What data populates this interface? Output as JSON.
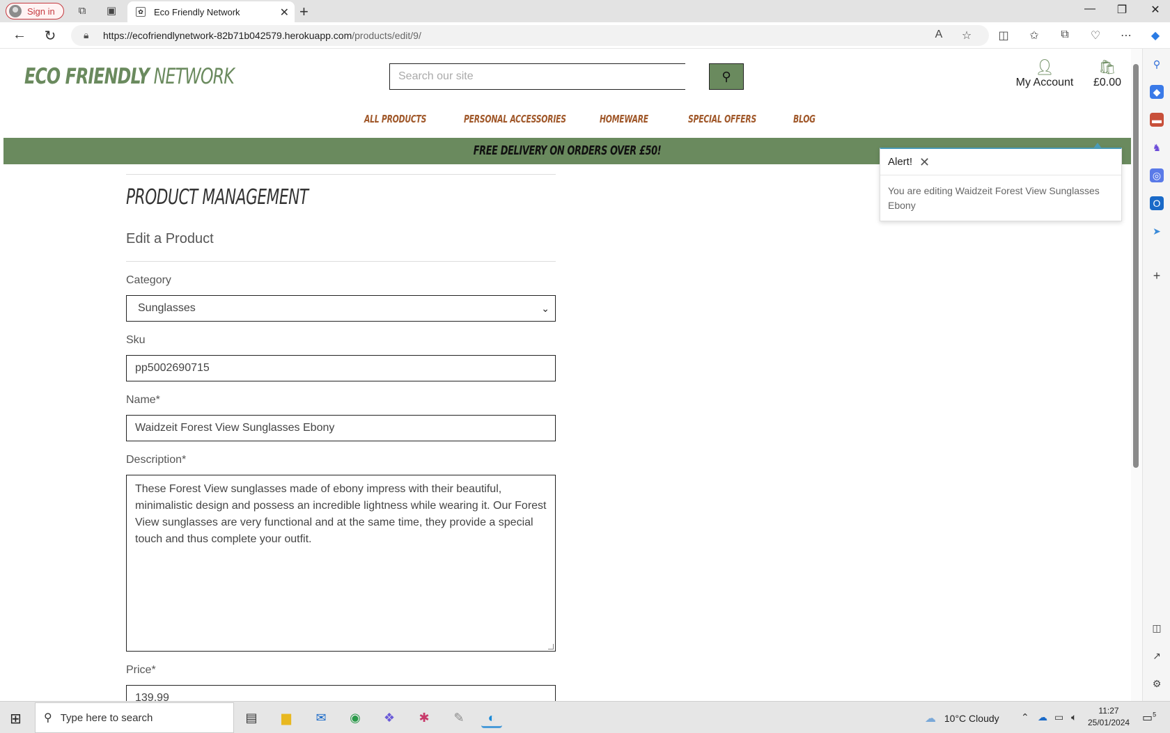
{
  "browser": {
    "signin_label": "Sign in",
    "tab_title": "Eco Friendly Network",
    "url_host": "https://ecofriendlynetwork-82b71b042579.herokuapp.com",
    "url_path": "/products/edit/9/"
  },
  "site": {
    "logo_bold": "ECO FRIENDLY",
    "logo_light": " NETWORK",
    "search_placeholder": "Search our site",
    "account_label": "My Account",
    "bag_total": "£0.00",
    "menu": [
      "ALL PRODUCTS",
      "PERSONAL ACCESSORIES",
      "HOMEWARE",
      "SPECIAL OFFERS",
      "BLOG"
    ],
    "banner": "FREE DELIVERY ON ORDERS OVER £50!"
  },
  "form": {
    "page_title": "PRODUCT MANAGEMENT",
    "subtitle": "Edit a Product",
    "category_label": "Category",
    "category_value": "Sunglasses",
    "sku_label": "Sku",
    "sku_value": "pp5002690715",
    "name_label": "Name*",
    "name_value": "Waidzeit Forest View Sunglasses Ebony",
    "description_label": "Description*",
    "description_value": "These Forest View sunglasses made of ebony impress with their beautiful, minimalistic design and possess an incredible lightness while wearing it. Our Forest View sunglasses are very functional and at the same time, they provide a special touch and thus complete your outfit.",
    "price_label": "Price*",
    "price_value": "139.99"
  },
  "toast": {
    "title": "Alert!",
    "message": "You are editing Waidzeit Forest View Sunglasses Ebony"
  },
  "taskbar": {
    "search_placeholder": "Type here to search",
    "weather": "10°C  Cloudy",
    "time": "11:27",
    "date": "25/01/2024",
    "notif_count": "5"
  },
  "colors": {
    "brand_green": "#6a8a5e",
    "menu_brown": "#a0582a",
    "toast_accent": "#4a9bb8"
  }
}
